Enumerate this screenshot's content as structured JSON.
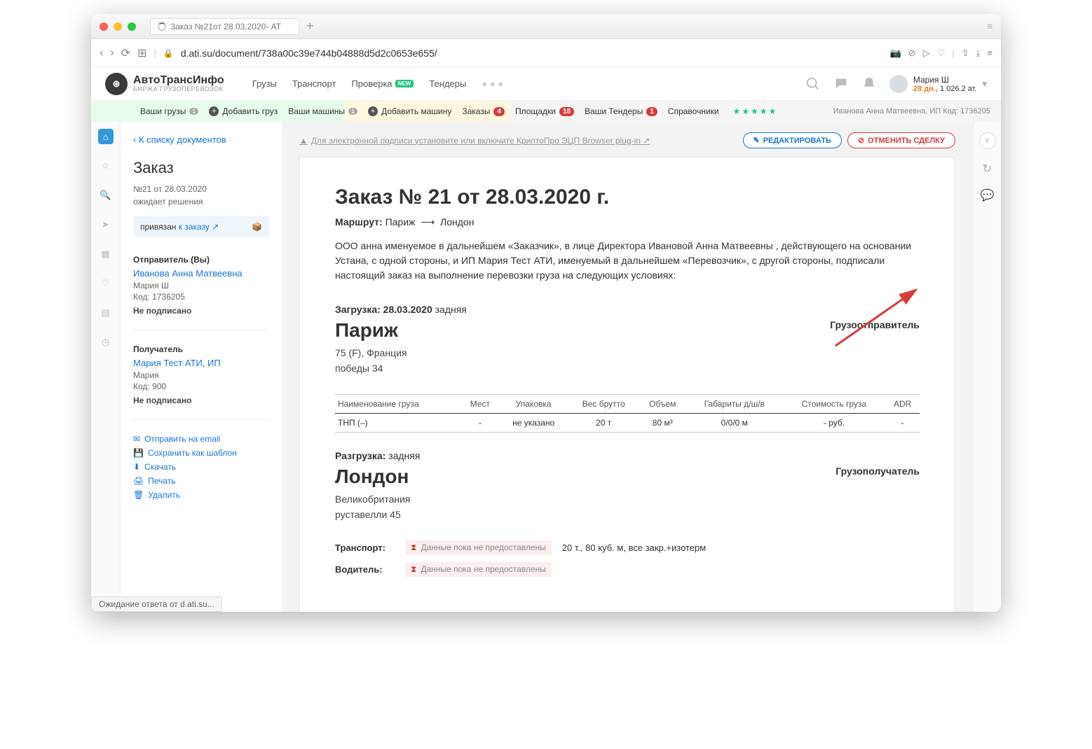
{
  "window": {
    "tab_title": "Заказ №21от 28.03.2020- АТ",
    "url": "d.ati.su/document/738a00c39e744b04888d5d2c0653e655/"
  },
  "logo": {
    "line1": "АвтоТрансИнфо",
    "line2": "БИРЖА ГРУЗОПЕРЕВОЗОК"
  },
  "nav": {
    "cargo": "Грузы",
    "transport": "Транспорт",
    "check": "Проверка",
    "new": "NEW",
    "tenders": "Тендеры"
  },
  "user": {
    "name": "Мария Ш",
    "days": "28 дн.,",
    "balance": "1 026.2 ат."
  },
  "subbar": {
    "your_cargo": "Ваши грузы",
    "your_cargo_n": "1",
    "add_cargo": "Добавить груз",
    "your_trucks": "Ваши машины",
    "your_trucks_n": "1",
    "add_truck": "Добавить машину",
    "orders": "Заказы",
    "orders_n": "4",
    "platforms": "Площадки",
    "platforms_n": "18",
    "your_tenders": "Ваши Тендеры",
    "your_tenders_n": "1",
    "directory": "Справочники",
    "right_text": "Иванова Анна Матвеевна, ИП  Код: 1736205"
  },
  "sidebar": {
    "back": "К списку документов",
    "title": "Заказ",
    "num": "№21 от 28.03.2020",
    "status": "ожидает решения",
    "linked_pre": "привязан ",
    "linked_link": "к заказу ↗",
    "sender_label": "Отправитель (Вы)",
    "sender_link": "Иванова Анна Матвеевна",
    "sender_name": "Мария Ш",
    "sender_code": "Код: 1736205",
    "sender_status": "Не подписано",
    "recv_label": "Получатель",
    "recv_link": "Мария Тест АТИ, ИП",
    "recv_name": "Мария",
    "recv_code": "Код: 900",
    "recv_status": "Не подписано",
    "act_email": "Отправить на email",
    "act_template": "Сохранить как шаблон",
    "act_download": "Скачать",
    "act_print": "Печать",
    "act_delete": "Удалить"
  },
  "main": {
    "warning": "Для электронной подписи установите или включите КриптоПро ЭЦП Browser plug-in ↗",
    "btn_edit": "РЕДАКТИРОВАТЬ",
    "btn_cancel": "ОТМЕНИТЬ СДЕЛКУ",
    "doc_title": "Заказ №  21 от 28.03.2020 г.",
    "route_label": "Маршрут:",
    "route_from": "Париж",
    "route_to": "Лондон",
    "paragraph": "ООО анна именуемое в дальнейшем «Заказчик», в лице Директора Ивановой Анна Матвеевны , действующего на основании Устана, с одной стороны, и ИП Мария Тест АТИ, именуемый в дальнейшем «Перевозчик», с другой стороны, подписали настоящий заказ на выполнение перевозки груза на следующих условиях:",
    "loading_label": "Загрузка: 28.03.2020",
    "loading_type": "задняя",
    "city1": "Париж",
    "addr1a": "75 (F), Франция",
    "addr1b": "победы 34",
    "sender_title": "Грузоотправитель",
    "table": {
      "h_name": "Наименование груза",
      "h_places": "Мест",
      "h_pack": "Упаковка",
      "h_gross": "Вес брутто",
      "h_vol": "Объем",
      "h_dims": "Габариты д/ш/в",
      "h_cost": "Стоимость груза",
      "h_adr": "ADR",
      "r_name": "ТНП (–)",
      "r_places": "-",
      "r_pack": "не указано",
      "r_gross": "20 т",
      "r_vol": "80 м³",
      "r_dims": "0/0/0 м",
      "r_cost": "- руб.",
      "r_adr": "-"
    },
    "unloading_label": "Разгрузка:",
    "unloading_type": "задняя",
    "city2": "Лондон",
    "addr2a": "Великобритания",
    "addr2b": "руставелли 45",
    "recv_title": "Грузополучатель",
    "transport_label": "Транспорт:",
    "pending": "Данные пока не предоставлены",
    "transport_info": "20 т., 80 куб. м, все закр.+изотерм",
    "driver_label": "Водитель:"
  },
  "status_bar": "Ожидание ответа от d.ati.su..."
}
